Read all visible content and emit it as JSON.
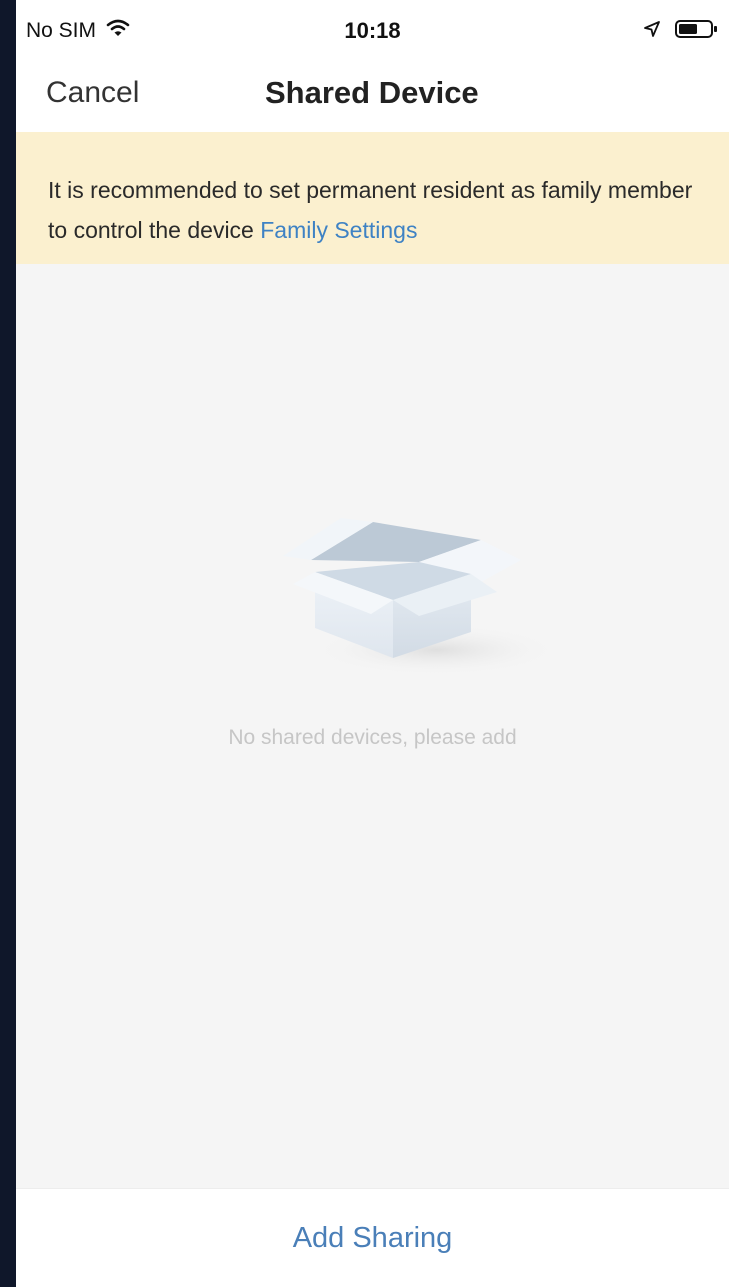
{
  "status_bar": {
    "carrier": "No SIM",
    "time": "10:18",
    "icons": [
      "wifi-icon",
      "location-arrow-icon",
      "battery-icon"
    ]
  },
  "nav": {
    "cancel_label": "Cancel",
    "title": "Shared Device"
  },
  "banner": {
    "text": "It is recommended to set permanent resident as family member to control the device ",
    "link_label": "Family Settings",
    "background": "#fbf0cf",
    "link_color": "#3e82c4"
  },
  "empty_state": {
    "icon": "empty-box-icon",
    "message": "No shared devices, please add"
  },
  "footer": {
    "add_label": "Add Sharing",
    "accent": "#4a7fb8"
  }
}
